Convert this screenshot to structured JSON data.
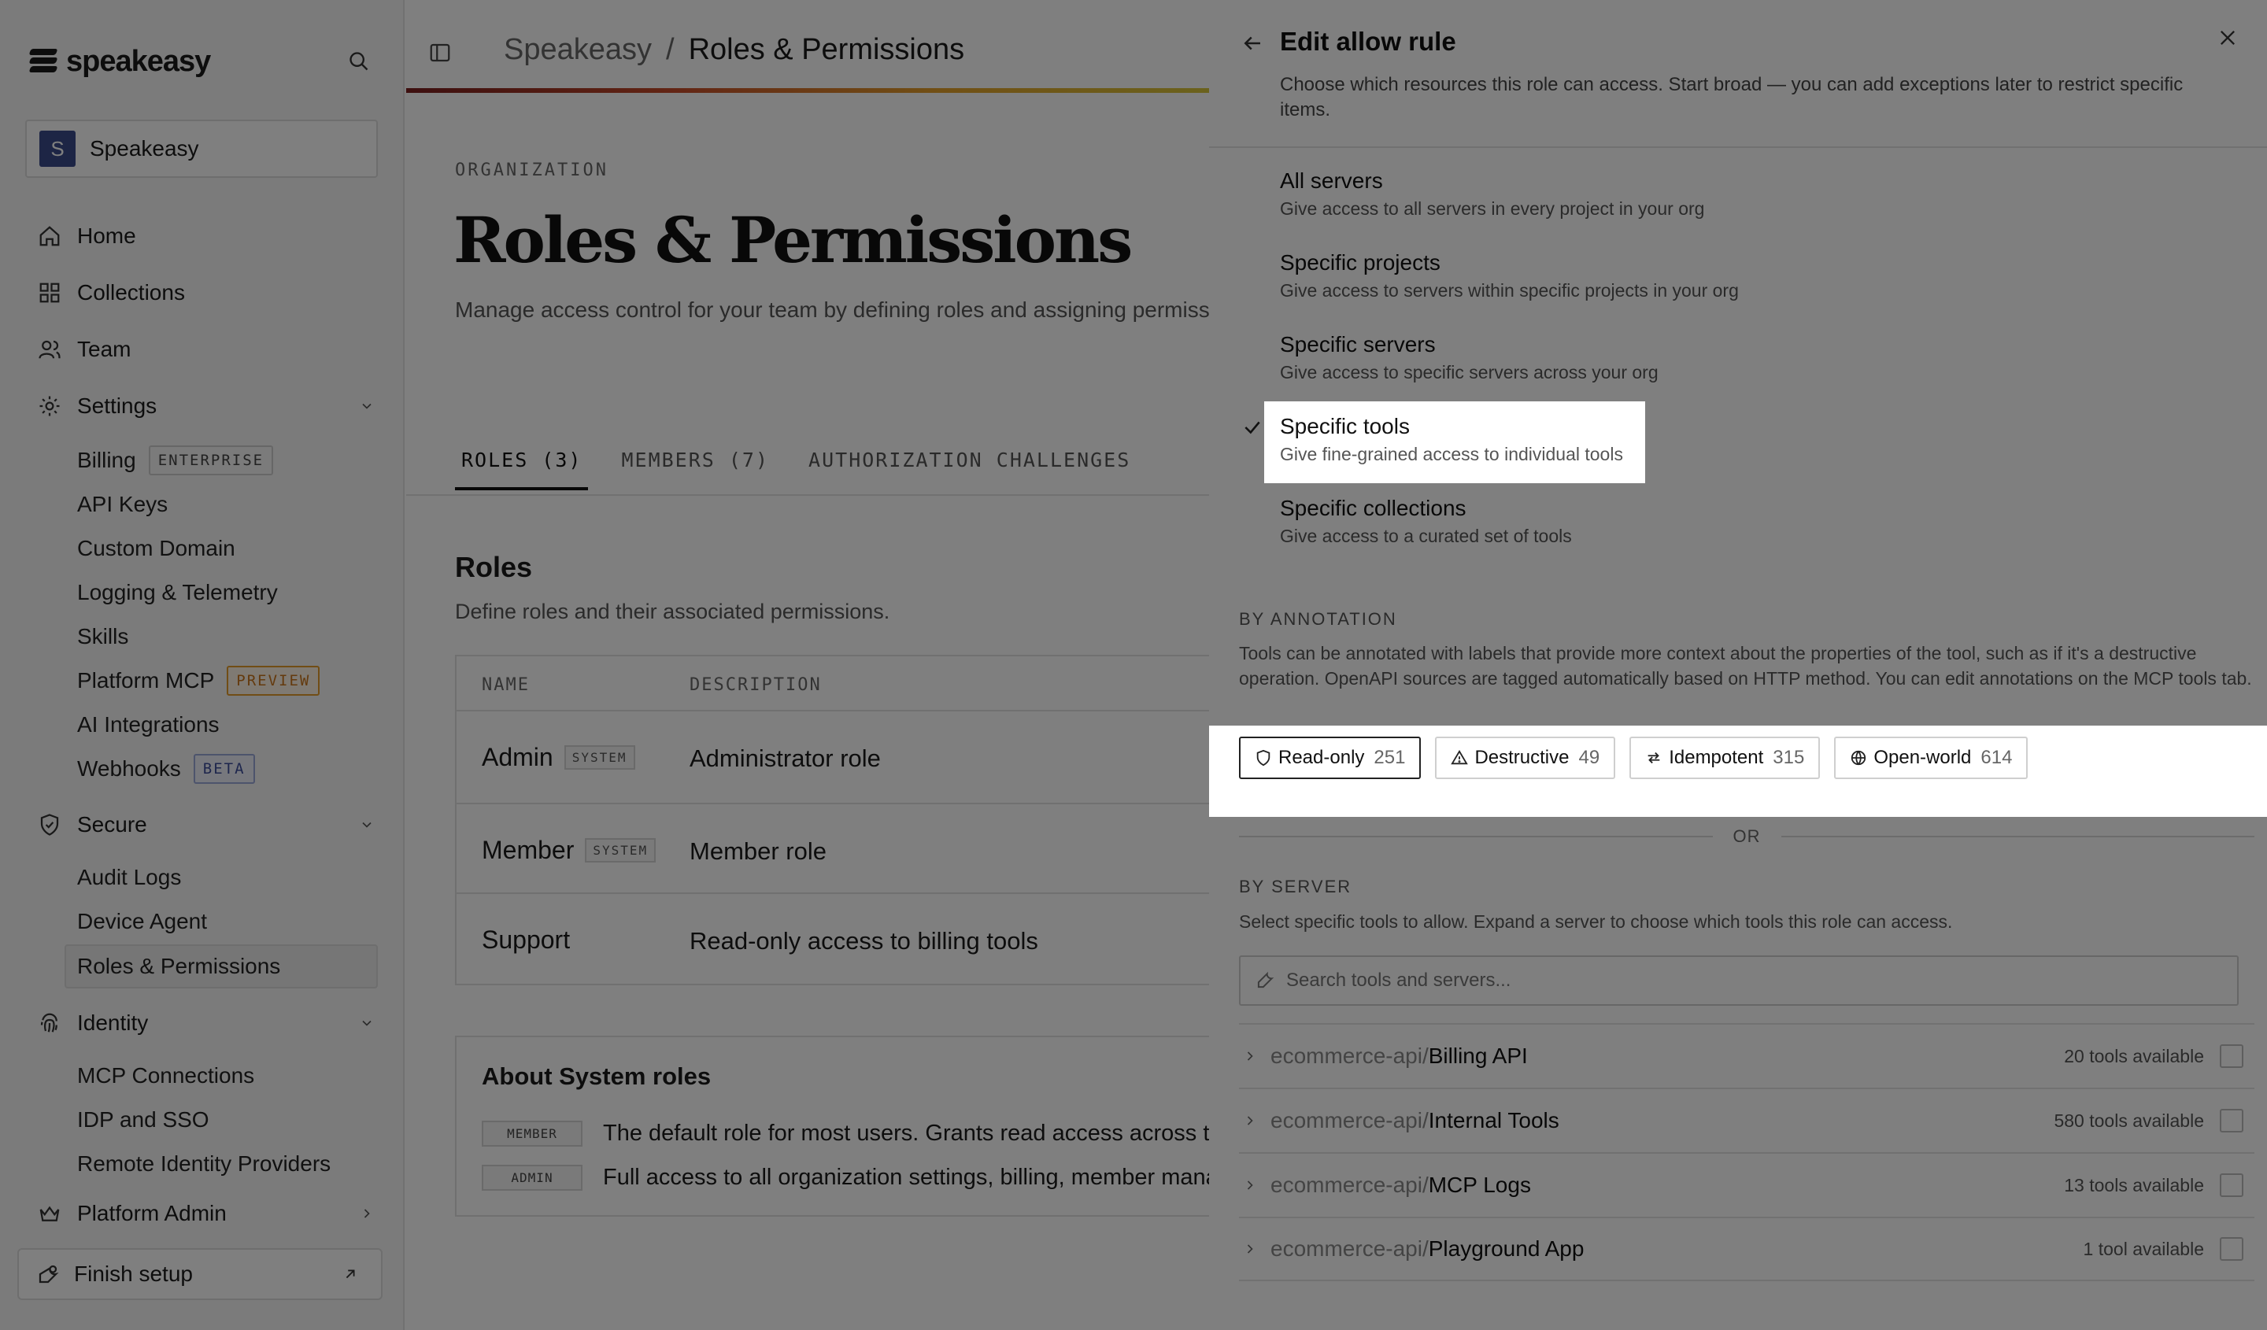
{
  "sidebar": {
    "brand": "speakeasy",
    "org": {
      "initial": "S",
      "name": "Speakeasy"
    },
    "nav": {
      "home": "Home",
      "collections": "Collections",
      "team": "Team",
      "settings": "Settings",
      "secure": "Secure",
      "identity": "Identity",
      "platform_admin": "Platform Admin"
    },
    "settings_items": {
      "billing": "Billing",
      "billing_badge": "ENTERPRISE",
      "api_keys": "API Keys",
      "custom_domain": "Custom Domain",
      "logging": "Logging & Telemetry",
      "skills": "Skills",
      "platform_mcp": "Platform MCP",
      "platform_mcp_badge": "PREVIEW",
      "ai_integrations": "AI Integrations",
      "webhooks": "Webhooks",
      "webhooks_badge": "BETA"
    },
    "secure_items": {
      "audit_logs": "Audit Logs",
      "device_agent": "Device Agent",
      "roles_permissions": "Roles & Permissions"
    },
    "identity_items": {
      "mcp_connections": "MCP Connections",
      "idp_sso": "IDP and SSO",
      "remote_idp": "Remote Identity Providers"
    },
    "finish_setup": "Finish setup"
  },
  "header": {
    "breadcrumb_root": "Speakeasy",
    "breadcrumb_sep": "/",
    "breadcrumb_current": "Roles & Permissions"
  },
  "page": {
    "kicker": "ORGANIZATION",
    "title": "Roles & Permissions",
    "description": "Manage access control for your team by defining roles and assigning permissi",
    "tabs": [
      "ROLES (3)",
      "MEMBERS (7)",
      "AUTHORIZATION CHALLENGES"
    ],
    "roles_title": "Roles",
    "roles_desc": "Define roles and their associated permissions.",
    "table_headers": [
      "NAME",
      "DESCRIPTION"
    ],
    "roles": [
      {
        "name": "Admin",
        "badge": "SYSTEM",
        "description": "Administrator role"
      },
      {
        "name": "Member",
        "badge": "SYSTEM",
        "description": "Member role"
      },
      {
        "name": "Support",
        "badge": "",
        "description": "Read-only access to billing tools"
      }
    ],
    "about": {
      "title": "About System roles",
      "rows": [
        {
          "tag": "MEMBER",
          "text": "The default role for most users. Grants read access across the o"
        },
        {
          "tag": "ADMIN",
          "text": "Full access to all organization settings, billing, member manage"
        }
      ]
    }
  },
  "drawer": {
    "title": "Edit allow rule",
    "subtitle": "Choose which resources this role can access. Start broad — you can add exceptions later to restrict specific items.",
    "options": [
      {
        "title": "All servers",
        "desc": "Give access to all servers in every project in your org",
        "selected": false
      },
      {
        "title": "Specific projects",
        "desc": "Give access to servers within specific projects in your org",
        "selected": false
      },
      {
        "title": "Specific servers",
        "desc": "Give access to specific servers across your org",
        "selected": false
      },
      {
        "title": "Specific tools",
        "desc": "Give fine-grained access to individual tools",
        "selected": true
      },
      {
        "title": "Specific collections",
        "desc": "Give access to a curated set of tools",
        "selected": false
      }
    ],
    "annotation_label": "BY ANNOTATION",
    "annotation_desc": "Tools can be annotated with labels that provide more context about the properties of the tool, such as if it's a destructive operation. OpenAPI sources are tagged automatically based on HTTP method. You can edit annotations on the MCP tools tab.",
    "chips": [
      {
        "label": "Read-only",
        "count": "251",
        "icon": "shield-icon",
        "active": true
      },
      {
        "label": "Destructive",
        "count": "49",
        "icon": "warning-icon",
        "active": false
      },
      {
        "label": "Idempotent",
        "count": "315",
        "icon": "repeat-icon",
        "active": false
      },
      {
        "label": "Open-world",
        "count": "614",
        "icon": "globe-icon",
        "active": false
      }
    ],
    "or_text": "OR",
    "server_label": "BY SERVER",
    "server_desc": "Select specific tools to allow. Expand a server to choose which tools this role can access.",
    "search_placeholder": "Search tools and servers...",
    "servers": [
      {
        "prefix": "ecommerce-api/",
        "name": "Billing API",
        "count": "20 tools available"
      },
      {
        "prefix": "ecommerce-api/",
        "name": "Internal Tools",
        "count": "580 tools available"
      },
      {
        "prefix": "ecommerce-api/",
        "name": "MCP Logs",
        "count": "13 tools available"
      },
      {
        "prefix": "ecommerce-api/",
        "name": "Playground App",
        "count": "1 tool available"
      }
    ]
  }
}
